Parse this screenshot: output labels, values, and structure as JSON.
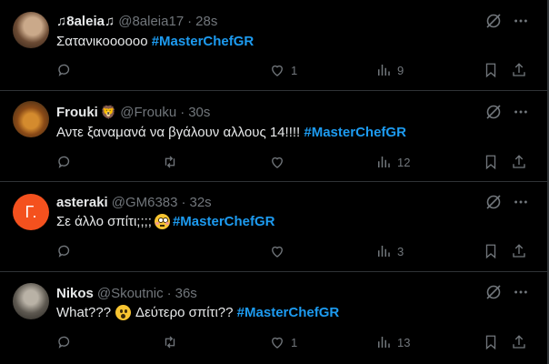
{
  "colors": {
    "accent": "#1d9bf0",
    "muted": "#71767b",
    "text": "#e7e9ea",
    "background": "#000000",
    "divider": "#2f3336"
  },
  "tweets": [
    {
      "name": "♫8aleia♫",
      "handle": "@8aleia17",
      "time": "28s",
      "text": "Σατανικοοοοοο",
      "hashtag": "#MasterChefGR",
      "likes": "1",
      "views": "9",
      "avatar_icon": "profile-photo"
    },
    {
      "name": "Frouki",
      "badge": "🦁",
      "handle": "@Frouku",
      "time": "30s",
      "text": "Αντε ξαναμανά να βγάλουν αλλους 14!!!!",
      "hashtag": "#MasterChefGR",
      "views": "12",
      "avatar_icon": "lion-photo"
    },
    {
      "name": "asteraki",
      "handle": "@GM6383",
      "time": "32s",
      "text": "Σε άλλο σπίτι;;;;",
      "emoji": "flushed-face",
      "hashtag": "#MasterChefGR",
      "views": "3",
      "avatar_letter": "Γ."
    },
    {
      "name": "Nikos",
      "handle": "@Skoutnic",
      "time": "36s",
      "text_before": "What???",
      "emoji": "surprised-face",
      "text": "Δεύτερο σπίτι??",
      "hashtag": "#MasterChefGR",
      "likes": "1",
      "views": "13",
      "avatar_icon": "profile-photo"
    }
  ]
}
